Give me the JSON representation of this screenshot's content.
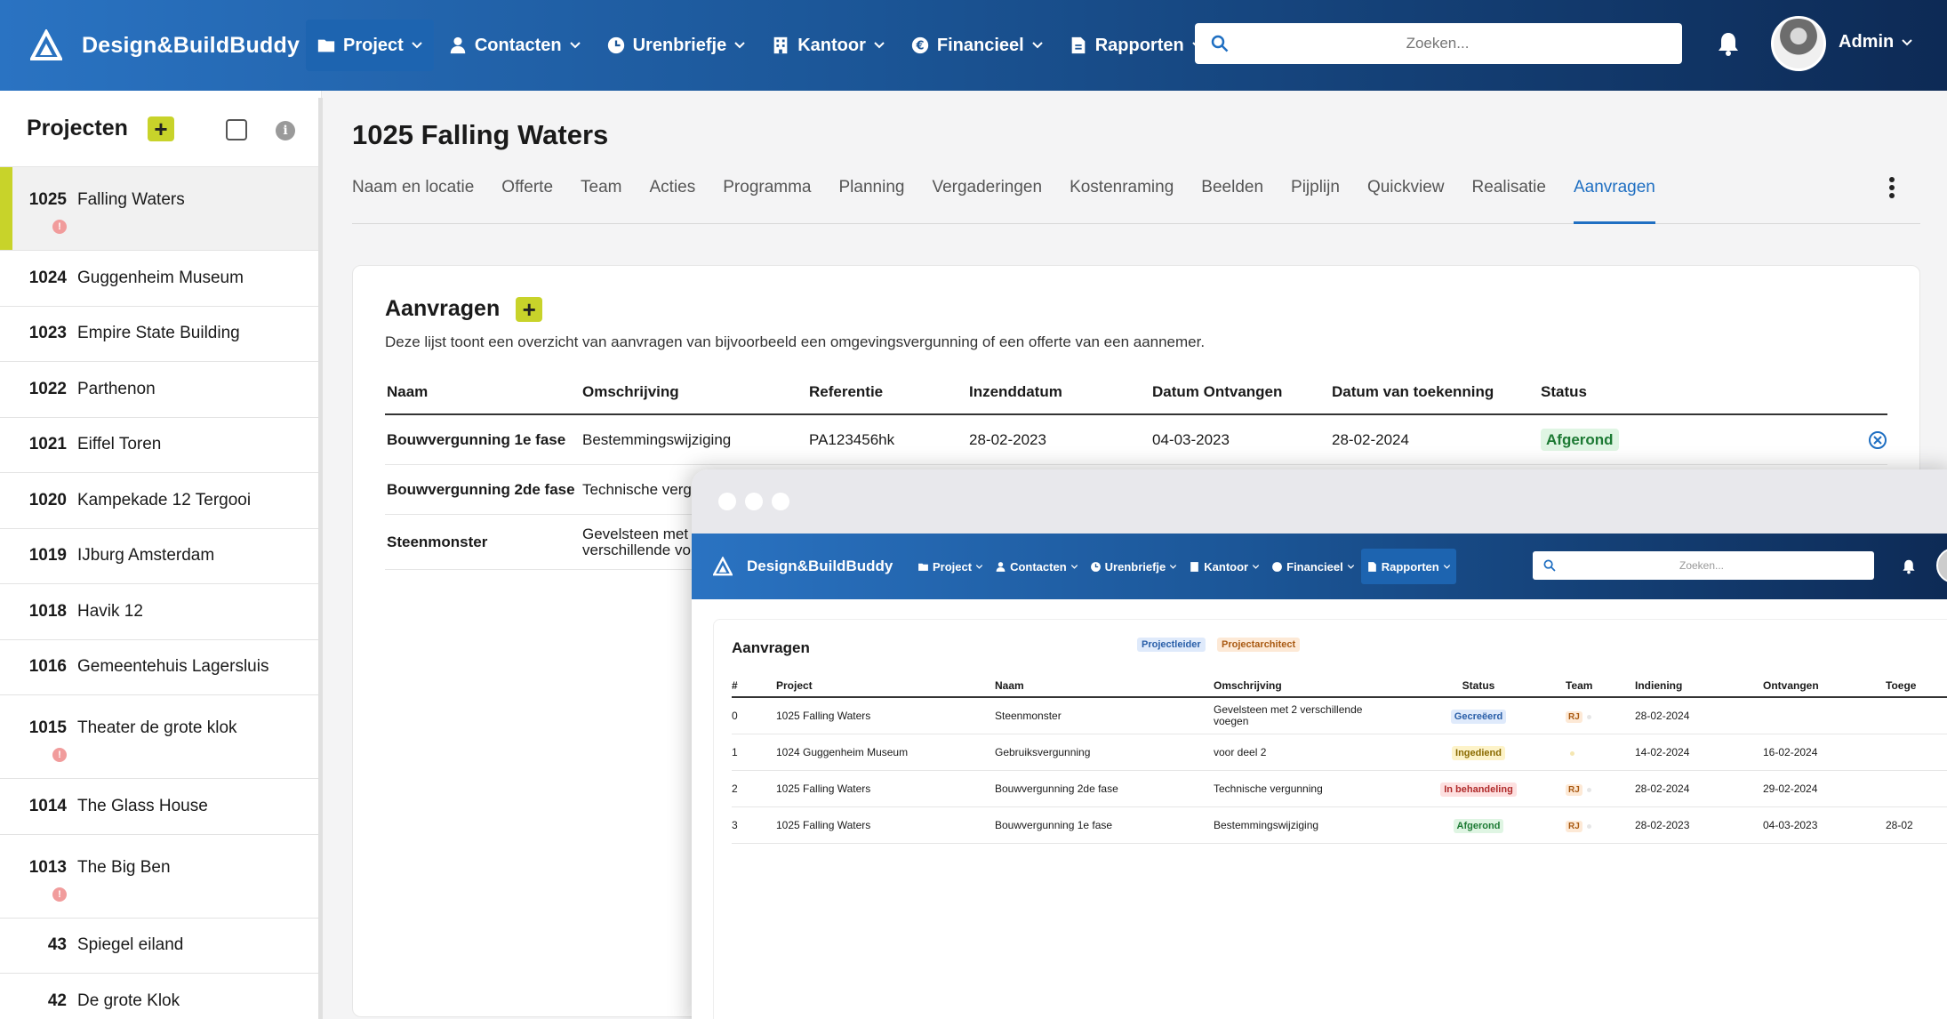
{
  "app": {
    "name": "Design&BuildBuddy"
  },
  "nav": {
    "items": [
      {
        "label": "Project",
        "icon": "folder-icon"
      },
      {
        "label": "Contacten",
        "icon": "person-icon"
      },
      {
        "label": "Urenbriefje",
        "icon": "clock-icon"
      },
      {
        "label": "Kantoor",
        "icon": "building-icon"
      },
      {
        "label": "Financieel",
        "icon": "euro-icon"
      },
      {
        "label": "Rapporten",
        "icon": "document-icon"
      }
    ],
    "search_placeholder": "Zoeken...",
    "user": "Admin"
  },
  "sidebar": {
    "title": "Projecten",
    "projects": [
      {
        "num": "1025",
        "name": "Falling Waters"
      },
      {
        "num": "1024",
        "name": "Guggenheim Museum"
      },
      {
        "num": "1023",
        "name": "Empire State Building"
      },
      {
        "num": "1022",
        "name": "Parthenon"
      },
      {
        "num": "1021",
        "name": "Eiffel Toren"
      },
      {
        "num": "1020",
        "name": "Kampekade 12 Tergooi"
      },
      {
        "num": "1019",
        "name": "IJburg Amsterdam"
      },
      {
        "num": "1018",
        "name": "Havik 12"
      },
      {
        "num": "1016",
        "name": "Gemeentehuis Lagersluis"
      },
      {
        "num": "1015",
        "name": "Theater de grote klok"
      },
      {
        "num": "1014",
        "name": "The Glass House"
      },
      {
        "num": "1013",
        "name": "The Big Ben"
      },
      {
        "num": "43",
        "name": "Spiegel eiland"
      },
      {
        "num": "42",
        "name": "De grote Klok"
      }
    ]
  },
  "main": {
    "title": "1025 Falling Waters",
    "tabs": [
      "Naam en locatie",
      "Offerte",
      "Team",
      "Acties",
      "Programma",
      "Planning",
      "Vergaderingen",
      "Kostenraming",
      "Beelden",
      "Pijplijn",
      "Quickview",
      "Realisatie",
      "Aanvragen"
    ],
    "active_tab": "Aanvragen",
    "section": {
      "title": "Aanvragen",
      "description": "Deze lijst toont een overzicht van aanvragen van bijvoorbeeld een omgevingsvergunning of een offerte van een aannemer.",
      "columns": [
        "Naam",
        "Omschrijving",
        "Referentie",
        "Inzenddatum",
        "Datum Ontvangen",
        "Datum van toekenning",
        "Status"
      ],
      "rows": [
        {
          "naam": "Bouwvergunning 1e fase",
          "omschrijving": "Bestemmingswijziging",
          "referentie": "PA123456hk",
          "inzenddatum": "28-02-2023",
          "ontvangen": "04-03-2023",
          "toekenning": "28-02-2024",
          "status": "Afgerond"
        },
        {
          "naam": "Bouwvergunning 2de fase",
          "omschrijving": "Technische verg",
          "referentie": "",
          "inzenddatum": "",
          "ontvangen": "",
          "toekenning": "",
          "status": ""
        },
        {
          "naam": "Steenmonster",
          "omschrijving": "Gevelsteen met",
          "omschrijving2": "verschillende vo",
          "referentie": "",
          "inzenddatum": "",
          "ontvangen": "",
          "toekenning": "",
          "status": ""
        }
      ]
    }
  },
  "overlay": {
    "nav_items": [
      "Project",
      "Contacten",
      "Urenbriefje",
      "Kantoor",
      "Financieel",
      "Rapporten"
    ],
    "search_placeholder": "Zoeken...",
    "title": "Aanvragen",
    "tags": [
      "Projectleider",
      "Projectarchitect"
    ],
    "columns": [
      "#",
      "Project",
      "Naam",
      "Omschrijving",
      "Status",
      "Team",
      "Indiening",
      "Ontvangen",
      "Toege"
    ],
    "rows": [
      {
        "idx": "0",
        "project": "1025 Falling Waters",
        "naam": "Steenmonster",
        "omschrijving": "Gevelsteen met 2 verschillende voegen",
        "status": "Gecreëerd",
        "team": "RJ",
        "indiening": "28-02-2024",
        "ontvangen": "",
        "toege": ""
      },
      {
        "idx": "1",
        "project": "1024 Guggenheim Museum",
        "naam": "Gebruiksvergunning",
        "omschrijving": "voor deel 2",
        "status": "Ingediend",
        "team": "",
        "indiening": "14-02-2024",
        "ontvangen": "16-02-2024",
        "toege": ""
      },
      {
        "idx": "2",
        "project": "1025 Falling Waters",
        "naam": "Bouwvergunning 2de fase",
        "omschrijving": "Technische vergunning",
        "status": "In behandeling",
        "team": "RJ",
        "indiening": "28-02-2024",
        "ontvangen": "29-02-2024",
        "toege": ""
      },
      {
        "idx": "3",
        "project": "1025 Falling Waters",
        "naam": "Bouwvergunning 1e fase",
        "omschrijving": "Bestemmingswijziging",
        "status": "Afgerond",
        "team": "RJ",
        "indiening": "28-02-2023",
        "ontvangen": "04-03-2023",
        "toege": "28-02"
      }
    ]
  },
  "colors": {
    "accent": "#c8d32a",
    "nav_start": "#2a73c2",
    "nav_end": "#0d2a55",
    "link": "#1f6fc2"
  }
}
